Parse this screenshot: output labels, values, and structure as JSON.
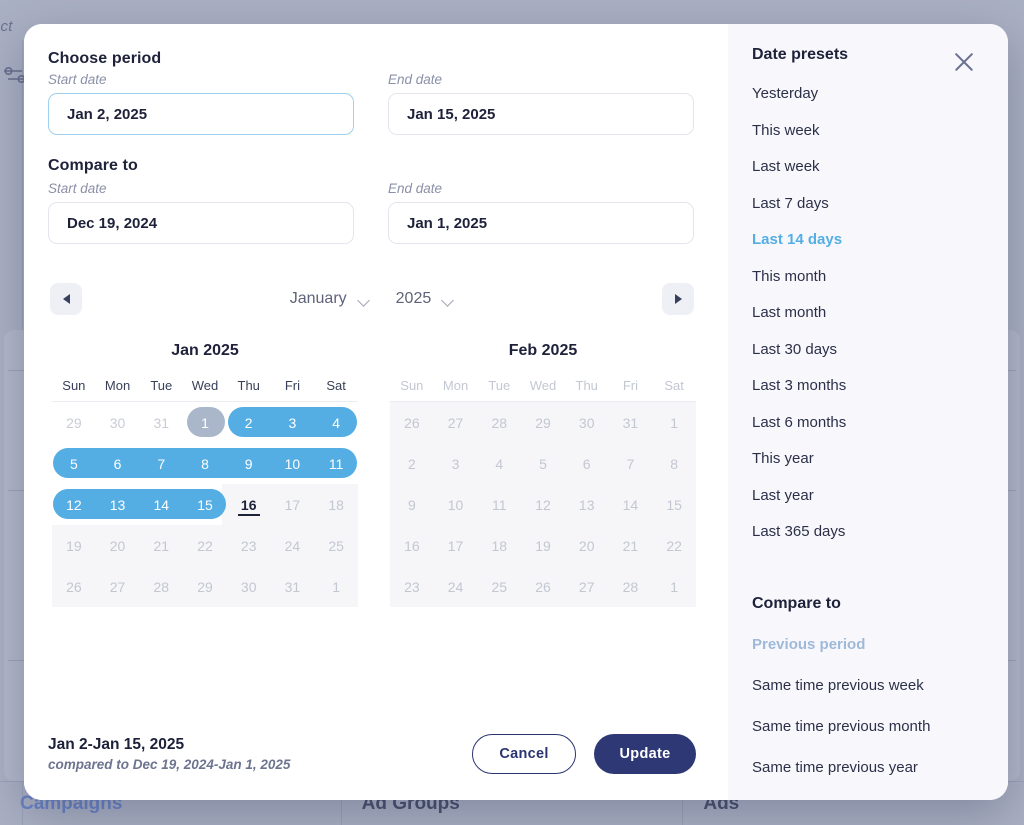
{
  "background": {
    "top_left_text": "ect",
    "filter_icon": "sliders-icon",
    "tabs": [
      {
        "label": "Campaigns",
        "active": true
      },
      {
        "label": "Ad Groups",
        "active": false
      },
      {
        "label": "Ads",
        "active": false
      }
    ]
  },
  "dialog": {
    "choose_period_title": "Choose period",
    "compare_to_title": "Compare to",
    "period": {
      "start_label": "Start date",
      "start_value": "Jan 2, 2025",
      "end_label": "End date",
      "end_value": "Jan 15, 2025"
    },
    "compare": {
      "start_label": "Start date",
      "start_value": "Dec 19, 2024",
      "end_label": "End date",
      "end_value": "Jan 1, 2025"
    },
    "nav": {
      "prev_icon": "caret-left-icon",
      "next_icon": "caret-right-icon",
      "month_select": "January",
      "year_select": "2025",
      "chevron_icon": "chevron-down-icon"
    },
    "weekdays": [
      "Sun",
      "Mon",
      "Tue",
      "Wed",
      "Thu",
      "Fri",
      "Sat"
    ],
    "months": [
      {
        "title": "Jan 2025",
        "weeks": [
          [
            {
              "d": "29",
              "s": "out"
            },
            {
              "d": "30",
              "s": "out"
            },
            {
              "d": "31",
              "s": "out"
            },
            {
              "d": "1",
              "s": "cmp"
            },
            {
              "d": "2",
              "s": "sel"
            },
            {
              "d": "3",
              "s": "sel"
            },
            {
              "d": "4",
              "s": "sel"
            }
          ],
          [
            {
              "d": "5",
              "s": "sel"
            },
            {
              "d": "6",
              "s": "sel"
            },
            {
              "d": "7",
              "s": "sel"
            },
            {
              "d": "8",
              "s": "sel"
            },
            {
              "d": "9",
              "s": "sel"
            },
            {
              "d": "10",
              "s": "sel"
            },
            {
              "d": "11",
              "s": "sel"
            }
          ],
          [
            {
              "d": "12",
              "s": "sel"
            },
            {
              "d": "13",
              "s": "sel"
            },
            {
              "d": "14",
              "s": "sel"
            },
            {
              "d": "15",
              "s": "sel"
            },
            {
              "d": "16",
              "s": "today"
            },
            {
              "d": "17",
              "s": "dim"
            },
            {
              "d": "18",
              "s": "dim"
            }
          ],
          [
            {
              "d": "19",
              "s": "dim"
            },
            {
              "d": "20",
              "s": "dim"
            },
            {
              "d": "21",
              "s": "dim"
            },
            {
              "d": "22",
              "s": "dim"
            },
            {
              "d": "23",
              "s": "dim"
            },
            {
              "d": "24",
              "s": "dim"
            },
            {
              "d": "25",
              "s": "dim"
            }
          ],
          [
            {
              "d": "26",
              "s": "dim"
            },
            {
              "d": "27",
              "s": "dim"
            },
            {
              "d": "28",
              "s": "dim"
            },
            {
              "d": "29",
              "s": "dim"
            },
            {
              "d": "30",
              "s": "dim"
            },
            {
              "d": "31",
              "s": "dim"
            },
            {
              "d": "1",
              "s": "dim"
            }
          ]
        ]
      },
      {
        "title": "Feb 2025",
        "weeks": [
          [
            {
              "d": "26",
              "s": "dim"
            },
            {
              "d": "27",
              "s": "dim"
            },
            {
              "d": "28",
              "s": "dim"
            },
            {
              "d": "29",
              "s": "dim"
            },
            {
              "d": "30",
              "s": "dim"
            },
            {
              "d": "31",
              "s": "dim"
            },
            {
              "d": "1",
              "s": "dim"
            }
          ],
          [
            {
              "d": "2",
              "s": "dim"
            },
            {
              "d": "3",
              "s": "dim"
            },
            {
              "d": "4",
              "s": "dim"
            },
            {
              "d": "5",
              "s": "dim"
            },
            {
              "d": "6",
              "s": "dim"
            },
            {
              "d": "7",
              "s": "dim"
            },
            {
              "d": "8",
              "s": "dim"
            }
          ],
          [
            {
              "d": "9",
              "s": "dim"
            },
            {
              "d": "10",
              "s": "dim"
            },
            {
              "d": "11",
              "s": "dim"
            },
            {
              "d": "12",
              "s": "dim"
            },
            {
              "d": "13",
              "s": "dim"
            },
            {
              "d": "14",
              "s": "dim"
            },
            {
              "d": "15",
              "s": "dim"
            }
          ],
          [
            {
              "d": "16",
              "s": "dim"
            },
            {
              "d": "17",
              "s": "dim"
            },
            {
              "d": "18",
              "s": "dim"
            },
            {
              "d": "19",
              "s": "dim"
            },
            {
              "d": "20",
              "s": "dim"
            },
            {
              "d": "21",
              "s": "dim"
            },
            {
              "d": "22",
              "s": "dim"
            }
          ],
          [
            {
              "d": "23",
              "s": "dim"
            },
            {
              "d": "24",
              "s": "dim"
            },
            {
              "d": "25",
              "s": "dim"
            },
            {
              "d": "26",
              "s": "dim"
            },
            {
              "d": "27",
              "s": "dim"
            },
            {
              "d": "28",
              "s": "dim"
            },
            {
              "d": "1",
              "s": "dim"
            }
          ]
        ]
      }
    ],
    "footer": {
      "summary": "Jan 2-Jan 15, 2025",
      "comparison": "compared to Dec 19, 2024-Jan 1, 2025",
      "cancel_label": "Cancel",
      "update_label": "Update"
    }
  },
  "panel": {
    "presets_title": "Date presets",
    "close_icon": "close-icon",
    "presets": [
      {
        "label": "Yesterday",
        "active": false
      },
      {
        "label": "This week",
        "active": false
      },
      {
        "label": "Last week",
        "active": false
      },
      {
        "label": "Last 7 days",
        "active": false
      },
      {
        "label": "Last 14 days",
        "active": true
      },
      {
        "label": "This month",
        "active": false
      },
      {
        "label": "Last month",
        "active": false
      },
      {
        "label": "Last 30 days",
        "active": false
      },
      {
        "label": "Last 3 months",
        "active": false
      },
      {
        "label": "Last 6 months",
        "active": false
      },
      {
        "label": "This year",
        "active": false
      },
      {
        "label": "Last year",
        "active": false
      },
      {
        "label": "Last 365 days",
        "active": false
      }
    ],
    "compare_title": "Compare to",
    "compare_options": [
      {
        "label": "Previous period",
        "active": true
      },
      {
        "label": "Same time previous week",
        "active": false
      },
      {
        "label": "Same time previous month",
        "active": false
      },
      {
        "label": "Same time previous year",
        "active": false
      }
    ]
  },
  "colors": {
    "range_blue": "#54aee4",
    "compare_grey": "#aab7cb",
    "accent_navy": "#2d3875",
    "muted_blue": "#9fb9d9"
  }
}
